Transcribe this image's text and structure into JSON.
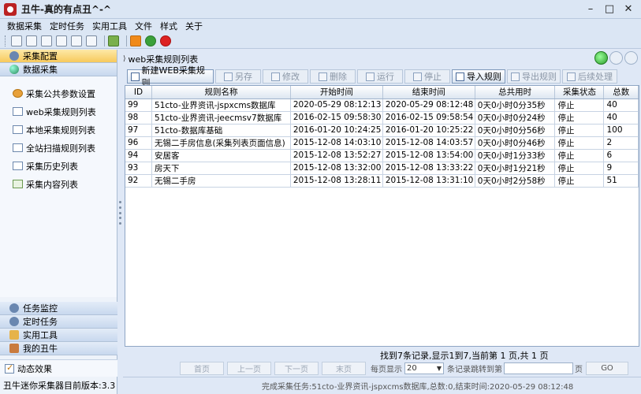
{
  "window": {
    "title": "丑牛-真的有点丑^-^",
    "minimize": "–",
    "maximize": "□",
    "close": "✕"
  },
  "menu": [
    "数据采集",
    "定时任务",
    "实用工具",
    "文件",
    "样式",
    "关于"
  ],
  "sidebar": {
    "top_sections": [
      {
        "label": "采集配置",
        "icon": "gear-icon"
      },
      {
        "label": "数据采集",
        "icon": "globe-icon"
      }
    ],
    "items": [
      {
        "label": "采集公共参数设置",
        "icon": "settings-icon"
      },
      {
        "label": "web采集规则列表",
        "icon": "window-icon"
      },
      {
        "label": "本地采集规则列表",
        "icon": "drive-icon"
      },
      {
        "label": "全站扫描规则列表",
        "icon": "scan-icon"
      },
      {
        "label": "采集历史列表",
        "icon": "window-icon"
      },
      {
        "label": "采集内容列表",
        "icon": "document-icon"
      }
    ],
    "bottom_sections": [
      {
        "label": "任务监控",
        "icon": "monitor-icon"
      },
      {
        "label": "定时任务",
        "icon": "clock-icon"
      },
      {
        "label": "实用工具",
        "icon": "toolbox-icon"
      },
      {
        "label": "我的丑牛",
        "icon": "home-icon"
      }
    ],
    "checkbox_label": "动态效果",
    "version": "丑牛迷你采集器目前版本:3.3"
  },
  "main": {
    "breadcrumb": "web采集规则列表",
    "actions": [
      {
        "label": "新建WEB采集规则",
        "enabled": true
      },
      {
        "label": "另存",
        "enabled": false
      },
      {
        "label": "修改",
        "enabled": false
      },
      {
        "label": "删除",
        "enabled": false
      },
      {
        "label": "运行",
        "enabled": false
      },
      {
        "label": "停止",
        "enabled": false
      },
      {
        "label": "导入规则",
        "enabled": true
      },
      {
        "label": "导出规则",
        "enabled": false
      },
      {
        "label": "后续处理",
        "enabled": false
      }
    ],
    "table": {
      "columns": [
        "ID",
        "规则名称",
        "开始时间",
        "结束时间",
        "总共用时",
        "采集状态",
        "总数"
      ],
      "rows": [
        [
          "99",
          "51cto-业界资讯-jspxcms数据库",
          "2020-05-29 08:12:13",
          "2020-05-29 08:12:48",
          "0天0小时0分35秒",
          "停止",
          "40"
        ],
        [
          "98",
          "51cto-业界资讯-jeecmsv7数据库",
          "2016-02-15 09:58:30",
          "2016-02-15 09:58:54",
          "0天0小时0分24秒",
          "停止",
          "40"
        ],
        [
          "97",
          "51cto-数据库基础",
          "2016-01-20 10:24:25",
          "2016-01-20 10:25:22",
          "0天0小时0分56秒",
          "停止",
          "100"
        ],
        [
          "96",
          "无锡二手房信息(采集列表页面信息)",
          "2015-12-08 14:03:10",
          "2015-12-08 14:03:57",
          "0天0小时0分46秒",
          "停止",
          "2"
        ],
        [
          "94",
          "安居客",
          "2015-12-08 13:52:27",
          "2015-12-08 13:54:00",
          "0天0小时1分33秒",
          "停止",
          "6"
        ],
        [
          "93",
          "房天下",
          "2015-12-08 13:32:00",
          "2015-12-08 13:33:22",
          "0天0小时1分21秒",
          "停止",
          "9"
        ],
        [
          "92",
          "无锡二手房",
          "2015-12-08 13:28:11",
          "2015-12-08 13:31:10",
          "0天0小时2分58秒",
          "停止",
          "51"
        ]
      ]
    },
    "summary": "找到7条记录,显示1到7,当前第 1 页,共 1 页",
    "pager": {
      "first": "首页",
      "prev": "上一页",
      "next": "下一页",
      "last": "末页",
      "per_page_label": "每页显示",
      "per_page_value": "20",
      "jump_label": "条记录跳转到第",
      "page_suffix": "页",
      "go": "GO"
    },
    "status": "完成采集任务:51cto-业界资讯-jspxcms数据库,总数:0,结束时间:2020-05-29 08:12:48"
  }
}
